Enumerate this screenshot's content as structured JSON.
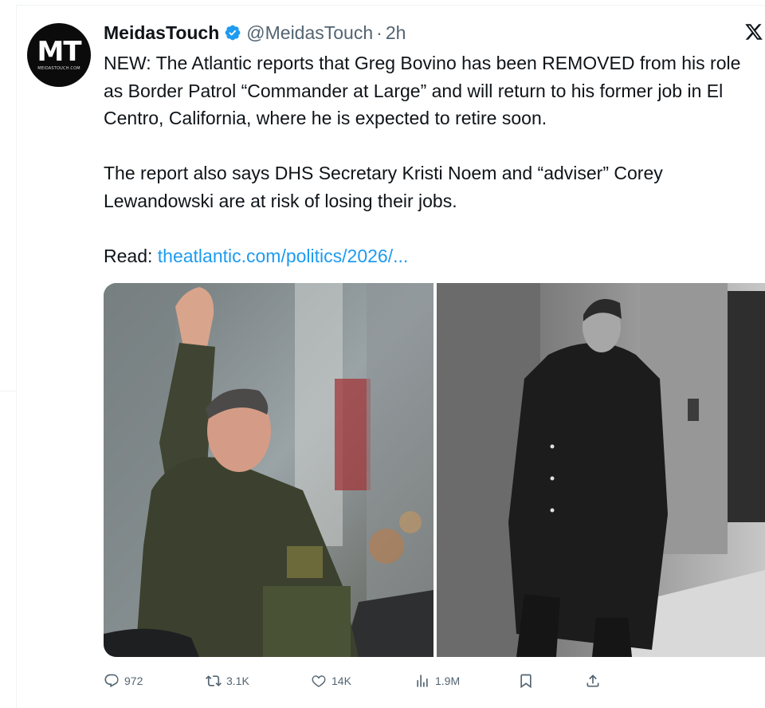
{
  "tweet": {
    "author_name": "MeidasTouch",
    "handle": "@MeidasTouch",
    "separator": "·",
    "time": "2h",
    "avatar_text": "MT",
    "avatar_subtext": "MEIDASTOUCH.COM",
    "verified_icon": "verified-badge-icon",
    "paragraphs": [
      "NEW: The Atlantic reports that Greg Bovino has been REMOVED from his role as Border Patrol “Commander at Large” and will return to his former job in El Centro, California, where he is expected to retire soon.",
      "The report also says DHS Secretary Kristi Noem and “adviser” Corey Lewandowski are at risk of losing their jobs."
    ],
    "read_label": "Read: ",
    "link_text": "theatlantic.com/politics/2026/..."
  },
  "actions": {
    "replies": "972",
    "reposts": "3.1K",
    "likes": "14K",
    "views": "1.9M"
  },
  "colors": {
    "link": "#1d9bf0",
    "secondary_text": "#536471",
    "verified": "#1d9bf0"
  }
}
